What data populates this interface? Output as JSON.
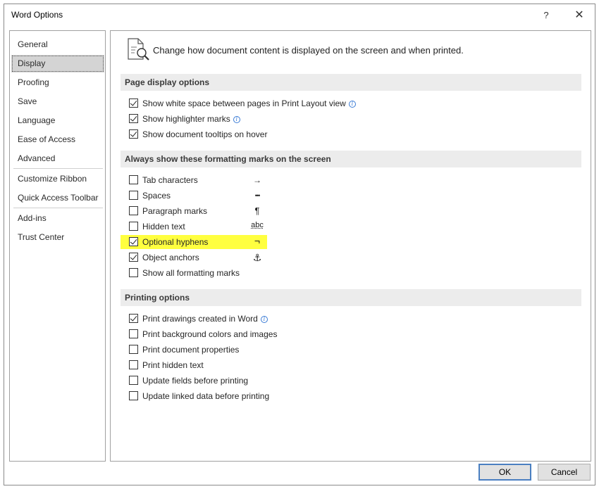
{
  "window": {
    "title": "Word Options",
    "help_label": "?",
    "close_label": "✕"
  },
  "sidebar": {
    "items": [
      {
        "label": "General"
      },
      {
        "label": "Display"
      },
      {
        "label": "Proofing"
      },
      {
        "label": "Save"
      },
      {
        "label": "Language"
      },
      {
        "label": "Ease of Access"
      },
      {
        "label": "Advanced"
      },
      {
        "label": "Customize Ribbon"
      },
      {
        "label": "Quick Access Toolbar"
      },
      {
        "label": "Add-ins"
      },
      {
        "label": "Trust Center"
      }
    ],
    "selected": "Display"
  },
  "header": {
    "text": "Change how document content is displayed on the screen and when printed.",
    "icon": "document-magnifier-icon"
  },
  "page_display": {
    "title": "Page display options",
    "options": [
      {
        "label": "Show white space between pages in Print Layout view",
        "checked": true,
        "info": true
      },
      {
        "label": "Show highlighter marks",
        "checked": true,
        "info": true
      },
      {
        "label": "Show document tooltips on hover",
        "checked": true,
        "info": false
      }
    ]
  },
  "formatting_marks": {
    "title": "Always show these formatting marks on the screen",
    "options": [
      {
        "label": "Tab characters",
        "checked": false,
        "mark": "→"
      },
      {
        "label": "Spaces",
        "checked": false,
        "mark": "•••"
      },
      {
        "label": "Paragraph marks",
        "checked": false,
        "mark": "¶"
      },
      {
        "label": "Hidden text",
        "checked": false,
        "mark": "abc"
      },
      {
        "label": "Optional hyphens",
        "checked": true,
        "mark": "¬",
        "highlighted": true,
        "highlight_color": "#ffff3f"
      },
      {
        "label": "Object anchors",
        "checked": true,
        "mark": "⚓"
      },
      {
        "label": "Show all formatting marks",
        "checked": false
      }
    ]
  },
  "printing": {
    "title": "Printing options",
    "options": [
      {
        "label": "Print drawings created in Word",
        "checked": true,
        "info": true
      },
      {
        "label": "Print background colors and images",
        "checked": false
      },
      {
        "label": "Print document properties",
        "checked": false
      },
      {
        "label": "Print hidden text",
        "checked": false
      },
      {
        "label": "Update fields before printing",
        "checked": false
      },
      {
        "label": "Update linked data before printing",
        "checked": false
      }
    ]
  },
  "buttons": {
    "ok": "OK",
    "cancel": "Cancel"
  }
}
